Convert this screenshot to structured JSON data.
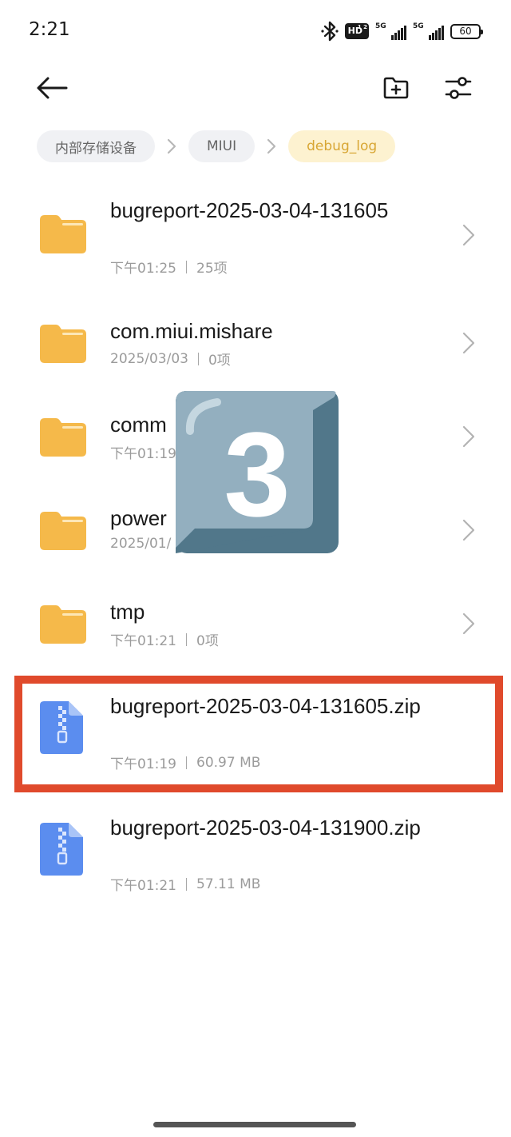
{
  "status_bar": {
    "time": "2:21",
    "hd_label": "HD",
    "hd_sub": "1 2",
    "sim1_label": "5G",
    "sim2_label": "5G",
    "battery": "60"
  },
  "icons": {
    "back": "arrow-left-icon",
    "new_folder": "folder-plus-icon",
    "filter": "sliders-icon",
    "breadcrumb_separator": "chevron-right-icon",
    "row_chevron": "chevron-right-icon",
    "folder": "folder-icon",
    "zip": "zip-file-icon",
    "overlay": "keycap-three-icon"
  },
  "colors": {
    "folder": "#f5b94a",
    "zip": "#5b8def",
    "active_crumb_bg": "#fdf2d0",
    "active_crumb_text": "#d8a634",
    "highlight": "#e04a2c",
    "keycap": "#93afbf"
  },
  "breadcrumb": {
    "items": [
      {
        "label": "内部存储设备"
      },
      {
        "label": "MIUI"
      },
      {
        "label": "debug_log"
      }
    ]
  },
  "files": [
    {
      "name": "bugreport-2025-03-04-131605",
      "date": "下午01:25",
      "info": "25项",
      "type": "folder"
    },
    {
      "name": "com.miui.mishare",
      "date": "2025/03/03",
      "info": "0项",
      "type": "folder"
    },
    {
      "name": "comm",
      "date": "下午01:19",
      "info": "",
      "type": "folder"
    },
    {
      "name": "power",
      "date": "2025/01/",
      "info": "",
      "type": "folder"
    },
    {
      "name": "tmp",
      "date": "下午01:21",
      "info": "0项",
      "type": "folder"
    },
    {
      "name": "bugreport-2025-03-04-131605.zip",
      "date": "下午01:19",
      "info": "60.97 MB",
      "type": "zip",
      "highlighted": true
    },
    {
      "name": "bugreport-2025-03-04-131900.zip",
      "date": "下午01:21",
      "info": "57.11 MB",
      "type": "zip"
    }
  ],
  "overlay": {
    "digit": "3"
  }
}
